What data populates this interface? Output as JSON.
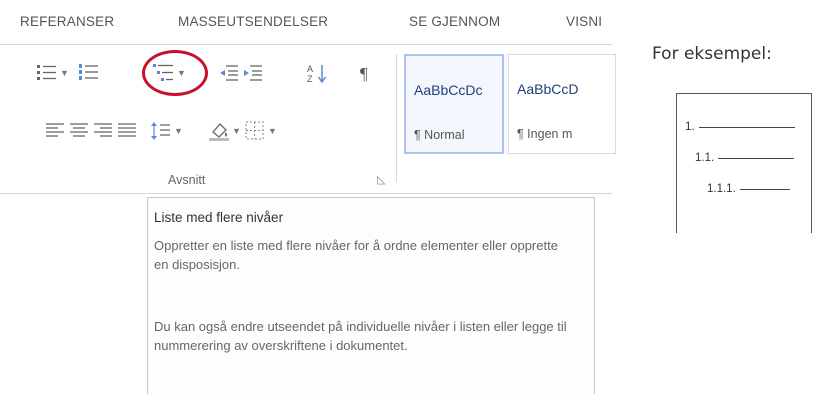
{
  "ribbon": {
    "tabs": [
      "REFERANSER",
      "MASSEUTSENDELSER",
      "SE GJENNOM",
      "VISNI"
    ],
    "paragraph_group": {
      "label": "Avsnitt",
      "tools_row1": [
        "bullets-icon",
        "numbering-icon",
        "multilevel-list-icon",
        "decrease-indent-icon",
        "increase-indent-icon",
        "sort-icon",
        "pilcrow-icon"
      ],
      "tools_row2": [
        "align-left-icon",
        "align-center-icon",
        "align-right-icon",
        "justify-icon",
        "line-spacing-icon",
        "shading-icon",
        "borders-icon"
      ],
      "highlight_color": "#c8102e"
    },
    "styles": [
      {
        "sample": "AaBbCcDc",
        "name": "¶ Normal"
      },
      {
        "sample": "AaBbCcD",
        "name": "¶ Ingen m"
      }
    ]
  },
  "tooltip": {
    "title": "Liste med flere nivåer",
    "paragraphs": [
      "Oppretter en liste med flere nivåer for å ordne elementer eller opprette en disposisjon.",
      "Du kan også endre utseendet på individuelle nivåer i listen eller legge til nummerering av overskriftene i dokumentet."
    ]
  },
  "example": {
    "label": "For eksempel:",
    "items": [
      "1.",
      "1.1.",
      "1.1.1."
    ]
  }
}
